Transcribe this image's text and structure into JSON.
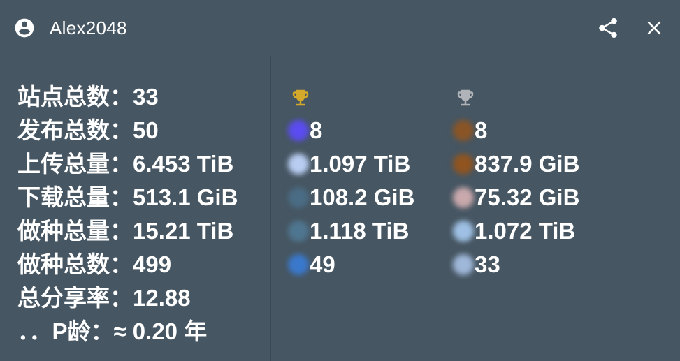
{
  "header": {
    "username": "Alex2048",
    "user_icon": "account-circle-icon",
    "share_icon": "share-icon",
    "close_icon": "close-icon"
  },
  "stats": [
    {
      "label": "站点总数：",
      "value": "33"
    },
    {
      "label": "发布总数：",
      "value": "50"
    },
    {
      "label": "上传总量：",
      "value": "6.453 TiB"
    },
    {
      "label": "下载总量：",
      "value": "513.1 GiB"
    },
    {
      "label": "做种总量：",
      "value": "15.21 TiB"
    },
    {
      "label": "做种总数：",
      "value": "499"
    },
    {
      "label": "总分享率：",
      "value": "12.88"
    },
    {
      "label": "．．P龄：",
      "value": "≈ 0.20 年"
    }
  ],
  "rankings": {
    "gold": {
      "trophy_color": "#d4a82a",
      "items": [
        {
          "value": "8",
          "blob_color": "#5a4cf0"
        },
        {
          "value": "1.097 TiB",
          "blob_color": "#b9cdf2"
        },
        {
          "value": "108.2 GiB",
          "blob_color": "#4a6c84"
        },
        {
          "value": "1.118 TiB",
          "blob_color": "#4f7690"
        },
        {
          "value": "49",
          "blob_color": "#3a78cc"
        }
      ]
    },
    "silver": {
      "trophy_color": "#b0b4b8",
      "items": [
        {
          "value": "8",
          "blob_color": "#8a5526"
        },
        {
          "value": "837.9 GiB",
          "blob_color": "#8f5420"
        },
        {
          "value": "75.32 GiB",
          "blob_color": "#c9a9ac"
        },
        {
          "value": "1.072 TiB",
          "blob_color": "#9fc0e4"
        },
        {
          "value": "33",
          "blob_color": "#9fb7d8"
        }
      ]
    }
  }
}
